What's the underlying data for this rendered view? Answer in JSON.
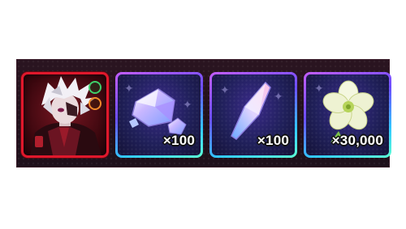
{
  "reward_panel": {
    "character": {
      "icon": "white-haired-hero-portrait",
      "frame_color": "#e0182c",
      "badges": [
        "green-element-badge",
        "orange-class-badge"
      ]
    },
    "items": [
      {
        "icon": "crystal-gem-icon",
        "quantity": "×100"
      },
      {
        "icon": "crystal-shard-icon",
        "quantity": "×100"
      },
      {
        "icon": "white-flower-icon",
        "quantity": "×30,000"
      }
    ]
  },
  "colors": {
    "background": "#ffffff",
    "panel": "#22101b",
    "hero_frame": "#e0182c",
    "item_frame_start": "#c45cff",
    "item_frame_end": "#5affd2"
  }
}
